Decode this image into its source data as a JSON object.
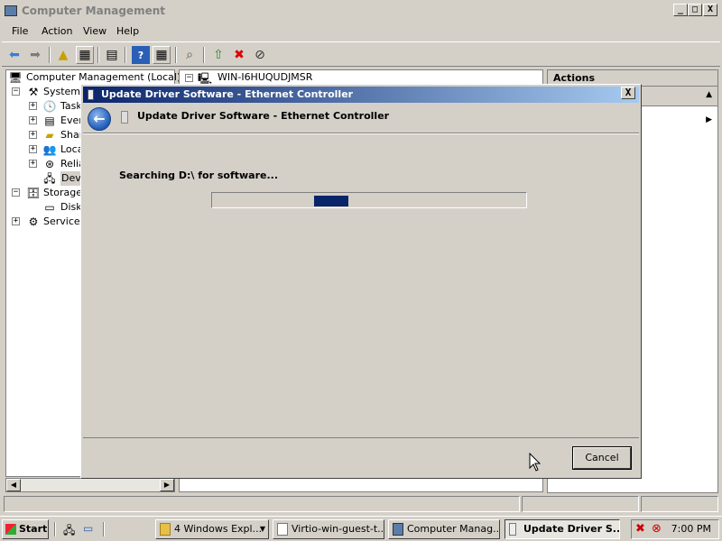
{
  "main_window": {
    "title": "Computer Management",
    "menu": [
      "File",
      "Action",
      "View",
      "Help"
    ],
    "title_buttons": {
      "minimize": "_",
      "maximize": "□",
      "close": "X"
    }
  },
  "tree": {
    "root": "Computer Management (Local)",
    "items": [
      {
        "label": "System T",
        "expander": "−",
        "icon": "tools-icon"
      },
      {
        "label": "Task",
        "expander": "+",
        "icon": "clock-icon"
      },
      {
        "label": "Ever",
        "expander": "+",
        "icon": "event-viewer-icon"
      },
      {
        "label": "Shar",
        "expander": "+",
        "icon": "shared-folder-icon"
      },
      {
        "label": "Loca",
        "expander": "+",
        "icon": "users-icon"
      },
      {
        "label": "Relia",
        "expander": "+",
        "icon": "reliability-icon"
      },
      {
        "label": "Devi",
        "expander": "",
        "icon": "device-manager-icon"
      },
      {
        "label": "Storage",
        "expander": "−",
        "icon": "storage-icon"
      },
      {
        "label": "Disk",
        "expander": "",
        "icon": "disk-icon"
      },
      {
        "label": "Services",
        "expander": "+",
        "icon": "services-icon"
      }
    ]
  },
  "center": {
    "node": "WIN-I6HUQUDJMSR",
    "expander": "−"
  },
  "actions": {
    "title": "Actions"
  },
  "dialog": {
    "title": "Update Driver Software - Ethernet Controller",
    "header": "Update Driver Software - Ethernet Controller",
    "status": "Searching D:\\ for software...",
    "cancel": "Cancel",
    "close": "X",
    "progress_marquee": true
  },
  "taskbar": {
    "start": "Start",
    "buttons": [
      {
        "label": "4 Windows Expl...",
        "icon": "folder-icon",
        "active": false
      },
      {
        "label": "Virtio-win-guest-t...",
        "icon": "document-icon",
        "active": false
      },
      {
        "label": "Computer Manag...",
        "icon": "computer-management-icon",
        "active": false
      },
      {
        "label": "Update Driver S...",
        "icon": "driver-icon",
        "active": true
      }
    ],
    "clock": "7:00 PM"
  },
  "colors": {
    "title_active": "#0a246a",
    "progress": "#0a246a",
    "window_face": "#d4d0c8"
  }
}
